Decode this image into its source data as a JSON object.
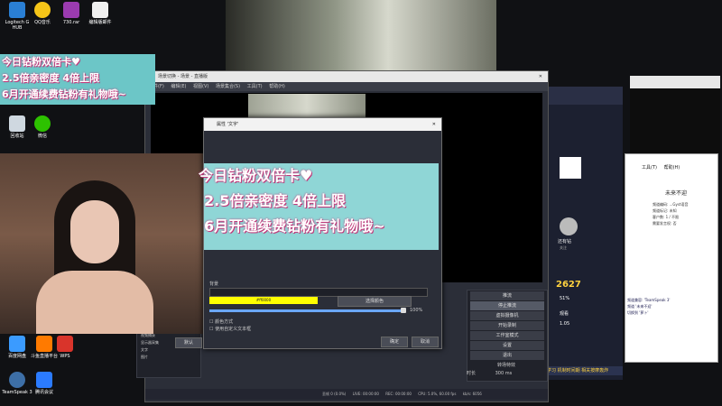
{
  "desktop": {
    "icons": [
      {
        "label": "Logitech G HUB",
        "color": "#2a7fd4"
      },
      {
        "label": "QQ音乐",
        "color": "#f5c518"
      },
      {
        "label": "730.rar",
        "color": "#9b3bb0"
      },
      {
        "label": "编辑版邮件",
        "color": "#f0f0f0"
      },
      {
        "label": "回收站",
        "color": "#cfd8e0"
      },
      {
        "label": "微信",
        "color": "#2dc100"
      },
      {
        "label": "百度网盘",
        "color": "#3b9bff"
      },
      {
        "label": "斗鱼直播平台",
        "color": "#ff7a00"
      },
      {
        "label": "WPS",
        "color": "#d9342b"
      },
      {
        "label": "TeamSpeak 3",
        "color": "#3d6fa7"
      },
      {
        "label": "腾讯会议",
        "color": "#2b7bff"
      }
    ]
  },
  "banner": {
    "line1": "今日钻粉双倍卡♥",
    "line2": "2.5倍亲密度 4倍上限",
    "line3": "6月开通续费钻粉有礼物哦~"
  },
  "obs": {
    "title": "场景切换 - 场景 - 直播版",
    "menu": [
      "文件(F)",
      "编辑(E)",
      "视图(V)",
      "场景集合(S)",
      "工具(T)",
      "帮助(H)"
    ],
    "controls": [
      "推流",
      "停止推流",
      "虚拟摄像机",
      "开始录制",
      "工作室模式",
      "设置",
      "退出"
    ],
    "transitions_label": "转场特效",
    "duration_label": "时长",
    "duration_value": "300 ms",
    "sources": [
      "视频捕获",
      "显示器采集",
      "文字",
      "图片"
    ],
    "status": {
      "dropped": "丢帧 0 (0.0%)",
      "live_label": "LIVE:",
      "live_time": "00:00:00",
      "rec_label": "REC:",
      "rec_time": "00:00:00",
      "cpu": "CPU: 5.0%, 60.00 fps",
      "kbps": "kb/s: 6056"
    }
  },
  "dialog": {
    "title": "属性 '文字'",
    "text_lines": [
      "今日钻粉双倍卡♥",
      "2.5倍亲密度 4倍上限",
      "6月开通续费钻粉有礼物哦~"
    ],
    "color_label": "背景",
    "color_value": "#ff0000",
    "color_swatch": "#ffff00",
    "select_color_button": "选择颜色",
    "opacity_value": "100%",
    "opacity_fraction": 1.0,
    "checkbox1": "颜色方式",
    "checkbox2": "使用自定义文本框",
    "ok_button": "确定",
    "cancel_button": "取消",
    "default_button": "默认"
  },
  "stream": {
    "room_id": "2627",
    "stats": [
      "51%",
      "观看",
      "1.05"
    ],
    "streamer": "还有钻",
    "followers": "关注",
    "banner_text": "学习 机制时间期 相关按摩轰炸"
  },
  "chat": {
    "menu": [
      "工具(T)",
      "帮助(H)"
    ],
    "header": "未来不迎",
    "rows": [
      "频道编码: ...Gyst语音",
      "频道标记: 未知",
      "客户数: 1 / 不限",
      "需要发言权: 否"
    ],
    "msg1": "频道兼容: 'TeamSpeak 3'",
    "msg2": "频道 '未来不迎'",
    "msg3": "切换到 '萝卜'"
  }
}
